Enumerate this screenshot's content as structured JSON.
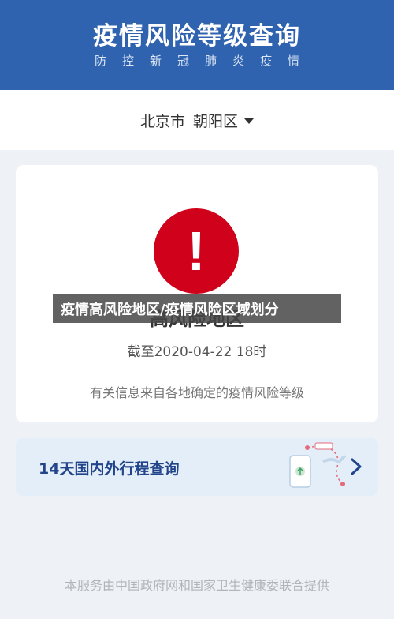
{
  "header": {
    "title": "疫情风险等级查询",
    "subtitle": "防控新冠肺炎疫情"
  },
  "region": {
    "city": "北京市",
    "district": "朝阳区"
  },
  "risk_card": {
    "alert_symbol": "!",
    "level_text": "高风险地区",
    "deadline": "截至2020-04-22 18时",
    "note": "有关信息来自各地确定的疫情风险等级"
  },
  "overlay_caption": "疫情高风险地区/疫情风险区域划分",
  "trip_query": {
    "label": "14天国内外行程查询",
    "icon": "chevron-right-icon"
  },
  "footer": "本服务由中国政府网和国家卫生健康委联合提供",
  "colors": {
    "header_bg": "#2f63b0",
    "alert_red": "#d0021b",
    "trip_card_bg": "#e4eef9"
  }
}
